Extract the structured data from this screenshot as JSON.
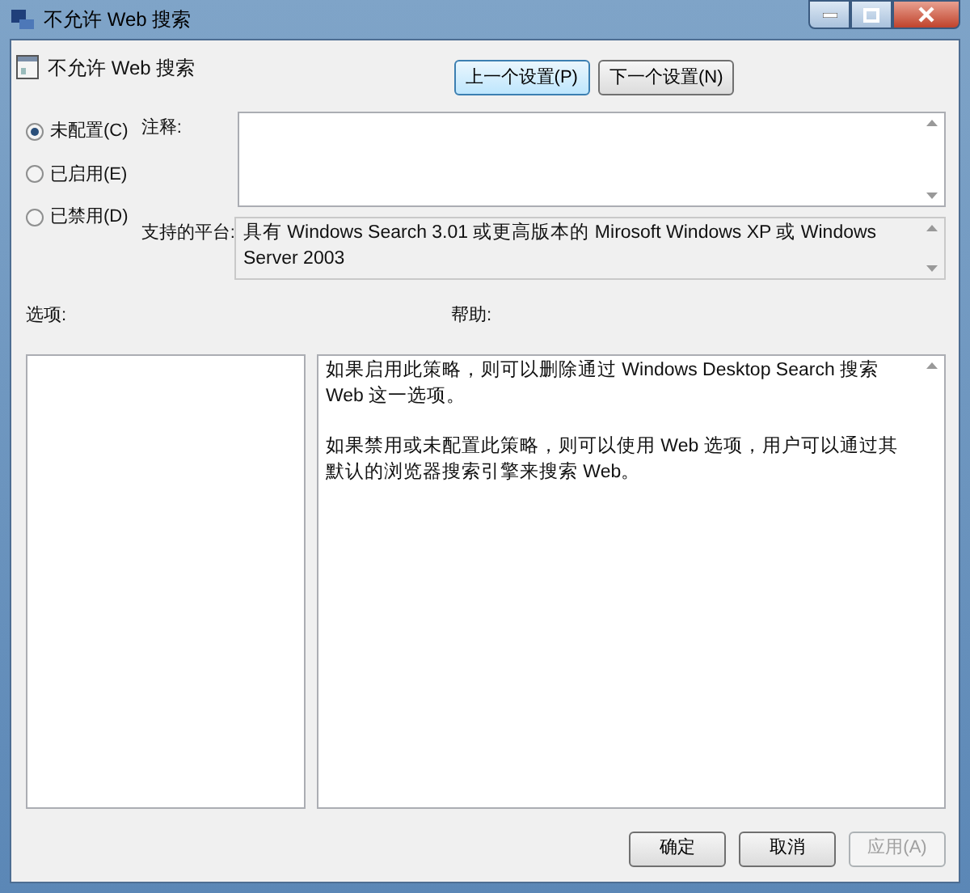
{
  "window": {
    "title": "不允许 Web 搜索"
  },
  "header": {
    "title": "不允许 Web 搜索"
  },
  "nav_buttons": [
    {
      "label": "上一个设置(P)",
      "focused": true
    },
    {
      "label": "下一个设置(N)",
      "focused": false
    }
  ],
  "radios": [
    {
      "label": "未配置(C)",
      "selected": true
    },
    {
      "label": "已启用(E)",
      "selected": false
    },
    {
      "label": "已禁用(D)",
      "selected": false
    }
  ],
  "comment": {
    "label": "注释:"
  },
  "platform": {
    "label": "支持的平台:",
    "text": "具有 Windows Search 3.01 或更高版本的 Mirosoft Windows XP 或 Windows Server 2003"
  },
  "options": {
    "label": "选项:"
  },
  "help": {
    "label": "帮助:",
    "paragraphs": [
      "如果启用此策略，则可以删除通过 Windows Desktop Search 搜索 Web 这一选项。",
      "如果禁用或未配置此策略，则可以使用 Web 选项，用户可以通过其默认的浏览器搜索引擎来搜索 Web。"
    ]
  },
  "buttons": [
    {
      "label": "确定",
      "disabled": false
    },
    {
      "label": "取消",
      "disabled": false
    },
    {
      "label": "应用(A)",
      "disabled": true
    }
  ]
}
